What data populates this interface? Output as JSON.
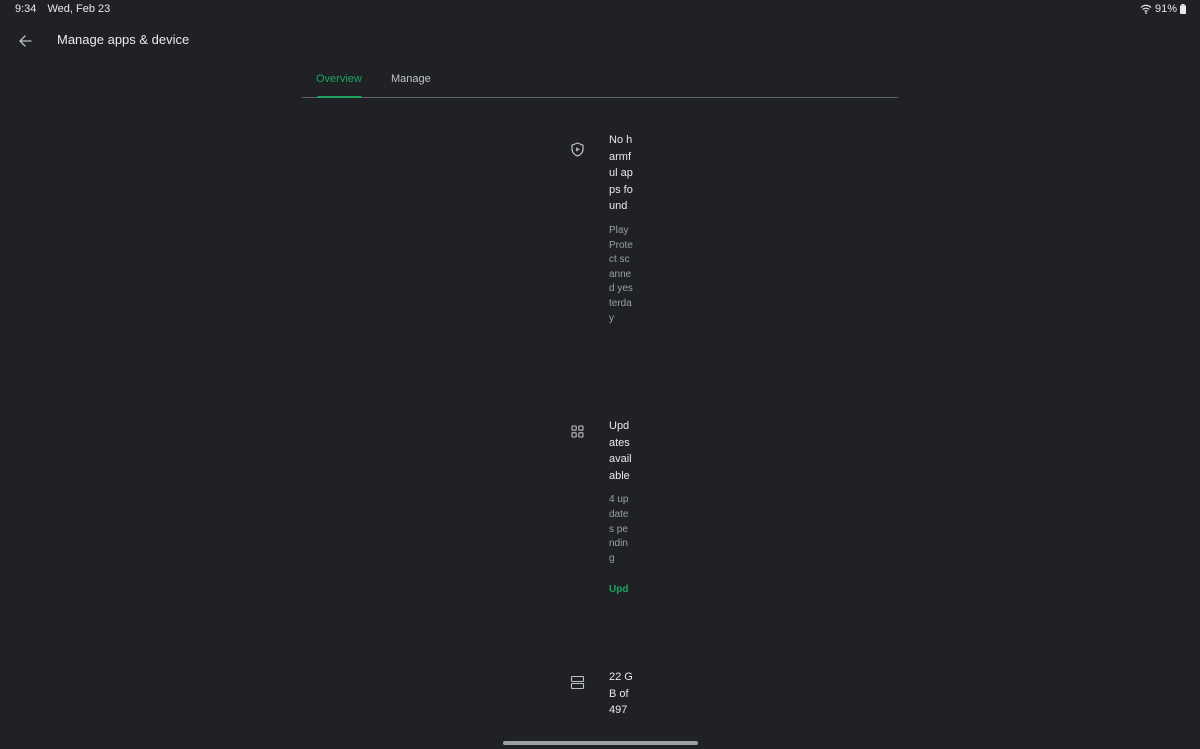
{
  "status_bar": {
    "time": "9:34",
    "date": "Wed, Feb 23",
    "battery": "91%",
    "wifi_icon": "wifi-icon",
    "battery_icon": "battery-icon"
  },
  "app_bar": {
    "back_icon": "arrow-left-icon",
    "title": "Manage apps & device"
  },
  "tabs": [
    {
      "label": "Overview",
      "selected": true
    },
    {
      "label": "Manage",
      "selected": false
    }
  ],
  "accent_color": "#1ea362",
  "cards": {
    "protect": {
      "icon": "shield-play-icon",
      "title": "No harmful apps found",
      "subtitle": "Play Protect scanned yesterday"
    },
    "updates": {
      "icon": "apps-grid-icon",
      "title": "Updates available",
      "subtitle": "4 updates pending",
      "action": "Upd"
    },
    "storage": {
      "icon": "storage-icon",
      "title": "22 GB of 497"
    }
  }
}
